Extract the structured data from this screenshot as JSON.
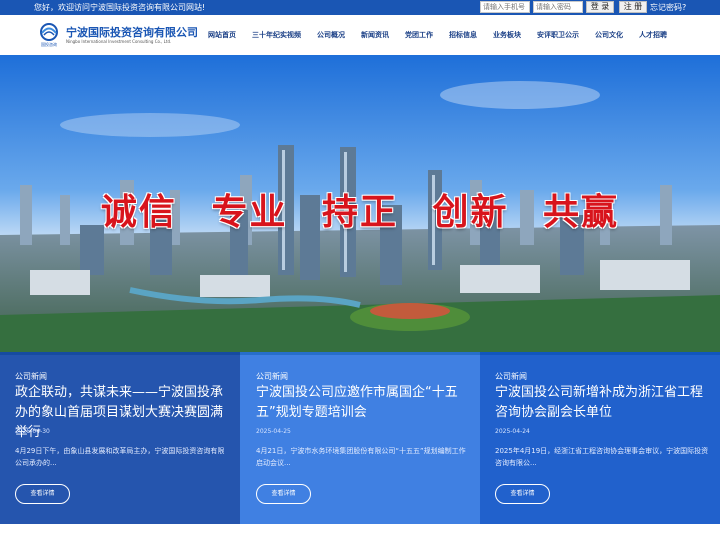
{
  "topbar": {
    "welcome": "您好，欢迎访问宁波国际投资咨询有限公司网站!",
    "phone_placeholder": "请输入手机号",
    "password_placeholder": "请输入密码",
    "login_label": "登 录",
    "register_label": "注 册",
    "forgot_label": "忘记密码?"
  },
  "header": {
    "logo_caption": "国投咨询",
    "company_cn": "宁波国际投资咨询有限公司",
    "company_en": "Ningbo International Investment Consulting Co., Ltd."
  },
  "nav": {
    "items": [
      {
        "label": "网站首页"
      },
      {
        "label": "三十年纪实视频"
      },
      {
        "label": "公司概况"
      },
      {
        "label": "新闻资讯"
      },
      {
        "label": "党团工作"
      },
      {
        "label": "招标信息"
      },
      {
        "label": "业务板块"
      },
      {
        "label": "安评职卫公示"
      },
      {
        "label": "公司文化"
      },
      {
        "label": "人才招聘"
      }
    ]
  },
  "banner": {
    "slogan": "诚信 专业 持正 创新 共赢"
  },
  "news": [
    {
      "category": "公司新闻",
      "title": "政企联动，共谋未来——宁波国投承办的象山首届项目谋划大赛决赛圆满举行",
      "date": "2025-04-30",
      "excerpt": "4月29日下午，由象山县发展和改革局主办，宁波国际投资咨询有限公司承办的...",
      "more": "查看详情"
    },
    {
      "category": "公司新闻",
      "title": "宁波国投公司应邀作市属国企“十五五”规划专题培训会",
      "date": "2025-04-25",
      "excerpt": "4月21日，宁波市水务环境集团股份有限公司“十五五”规划编制工作启动会议...",
      "more": "查看详情"
    },
    {
      "category": "公司新闻",
      "title": "宁波国投公司新增补成为浙江省工程咨询协会副会长单位",
      "date": "2025-04-24",
      "excerpt": "2025年4月19日，经浙江省工程咨询协会理事会审议，宁波国际投资咨询有限公...",
      "more": "查看详情"
    }
  ],
  "colors": {
    "brand_blue": "#1a56b4",
    "slogan_red": "#d8141c"
  }
}
